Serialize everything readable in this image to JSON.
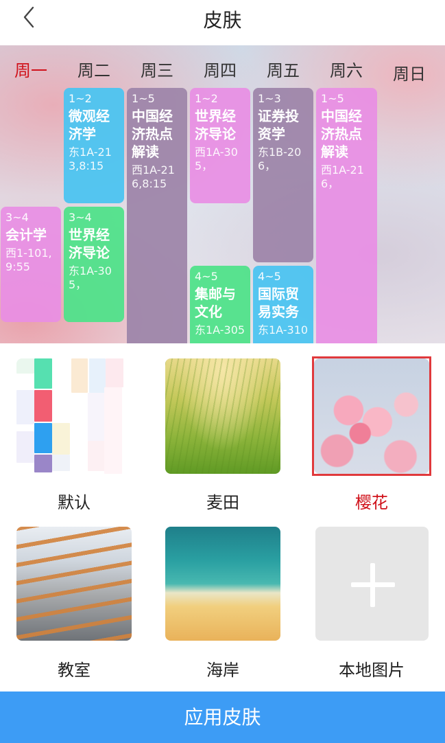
{
  "header": {
    "title": "皮肤",
    "back_icon": "chevron-left-icon"
  },
  "preview": {
    "days": [
      "周一",
      "周二",
      "周三",
      "周四",
      "周五",
      "周六",
      "周日"
    ],
    "active_day_index": 0,
    "courses": [
      {
        "period": "1~2",
        "name": "微观经济学",
        "room": "东1A-213,8:15",
        "color": "blue"
      },
      {
        "period": "1~5",
        "name": "中国经济热点解读",
        "room": "西1A-216,8:15",
        "color": "grey"
      },
      {
        "period": "1~2",
        "name": "世界经济导论",
        "room": "西1A-305，",
        "color": "pink"
      },
      {
        "period": "1~3",
        "name": "证券投资学",
        "room": "东1B-206，",
        "color": "grey"
      },
      {
        "period": "1~5",
        "name": "中国经济热点解读",
        "room": "西1A-216，",
        "color": "pink"
      },
      {
        "period": "3~4",
        "name": "会计学",
        "room": "西1-101,9:55",
        "color": "pink"
      },
      {
        "period": "3~4",
        "name": "世界经济导论",
        "room": "东1A-305，",
        "color": "green"
      },
      {
        "period": "4~5",
        "name": "集邮与文化",
        "room": "东1A-305",
        "color": "green"
      },
      {
        "period": "4~5",
        "name": "国际贸易实务",
        "room": "东1A-310",
        "color": "blue"
      }
    ]
  },
  "skins": [
    {
      "label": "默认",
      "selected": false
    },
    {
      "label": "麦田",
      "selected": false
    },
    {
      "label": "樱花",
      "selected": true
    },
    {
      "label": "教室",
      "selected": false
    },
    {
      "label": "海岸",
      "selected": false
    },
    {
      "label": "本地图片",
      "selected": false,
      "icon": "plus-icon"
    }
  ],
  "apply_button": {
    "label": "应用皮肤",
    "color": "#3d9cf5"
  },
  "colors": {
    "accent_red": "#d0121b",
    "selected_border": "#e0393c"
  }
}
